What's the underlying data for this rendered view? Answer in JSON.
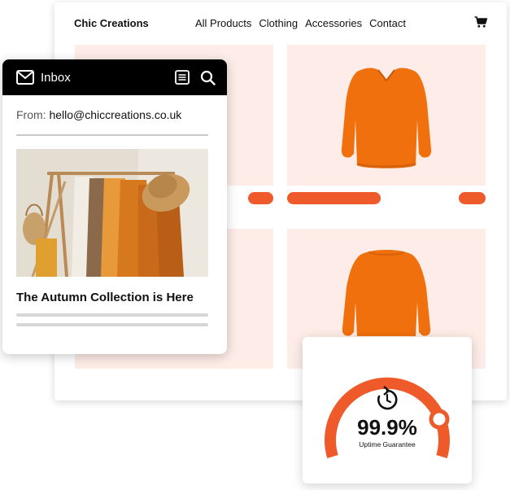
{
  "store": {
    "brand": "Chic Creations",
    "nav": [
      "All Products",
      "Clothing",
      "Accessories",
      "Contact"
    ],
    "cart_icon": "cart-icon",
    "accent": "#EE5A2A",
    "tile_bg": "#FDECE7"
  },
  "email": {
    "title": "Inbox",
    "from_label": "From:",
    "from_address": "hello@chiccreations.co.uk",
    "headline": "The Autumn Collection is Here",
    "icons": [
      "mail-icon",
      "list-icon",
      "search-icon"
    ]
  },
  "uptime": {
    "value": "99.9%",
    "caption": "Uptime Guarantee",
    "icon": "refresh-clock-icon"
  }
}
